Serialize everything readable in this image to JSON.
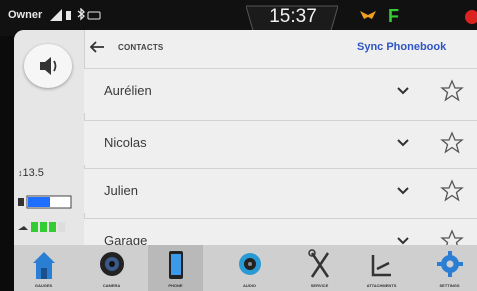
{
  "status_bar": {
    "profile": "Owner",
    "time": "15:37",
    "gear": "F"
  },
  "left_panel": {
    "odometer": "13.5"
  },
  "header": {
    "title": "CONTACTS",
    "sync_label": "Sync Phonebook"
  },
  "contacts": [
    {
      "name": "Aurélien"
    },
    {
      "name": "Nicolas"
    },
    {
      "name": "Julien"
    },
    {
      "name": "Garage"
    }
  ],
  "dock": {
    "items": [
      {
        "label": "GAUGES",
        "icon": "home-icon"
      },
      {
        "label": "CAMERA",
        "icon": "camera-icon"
      },
      {
        "label": "PHONE",
        "icon": "phone-icon",
        "active": true
      },
      {
        "label": "AUDIO",
        "icon": "speaker-icon"
      },
      {
        "label": "SERVICE",
        "icon": "tools-icon"
      },
      {
        "label": "ATTACHMENTS",
        "icon": "attachments-icon"
      },
      {
        "label": "SETTINGS",
        "icon": "settings-gear-icon"
      }
    ]
  },
  "colors": {
    "accent_blue": "#2f55c4",
    "gear_green": "#33cc33",
    "battery_blue": "#1e6fff",
    "oil_green": "#33cc33"
  }
}
